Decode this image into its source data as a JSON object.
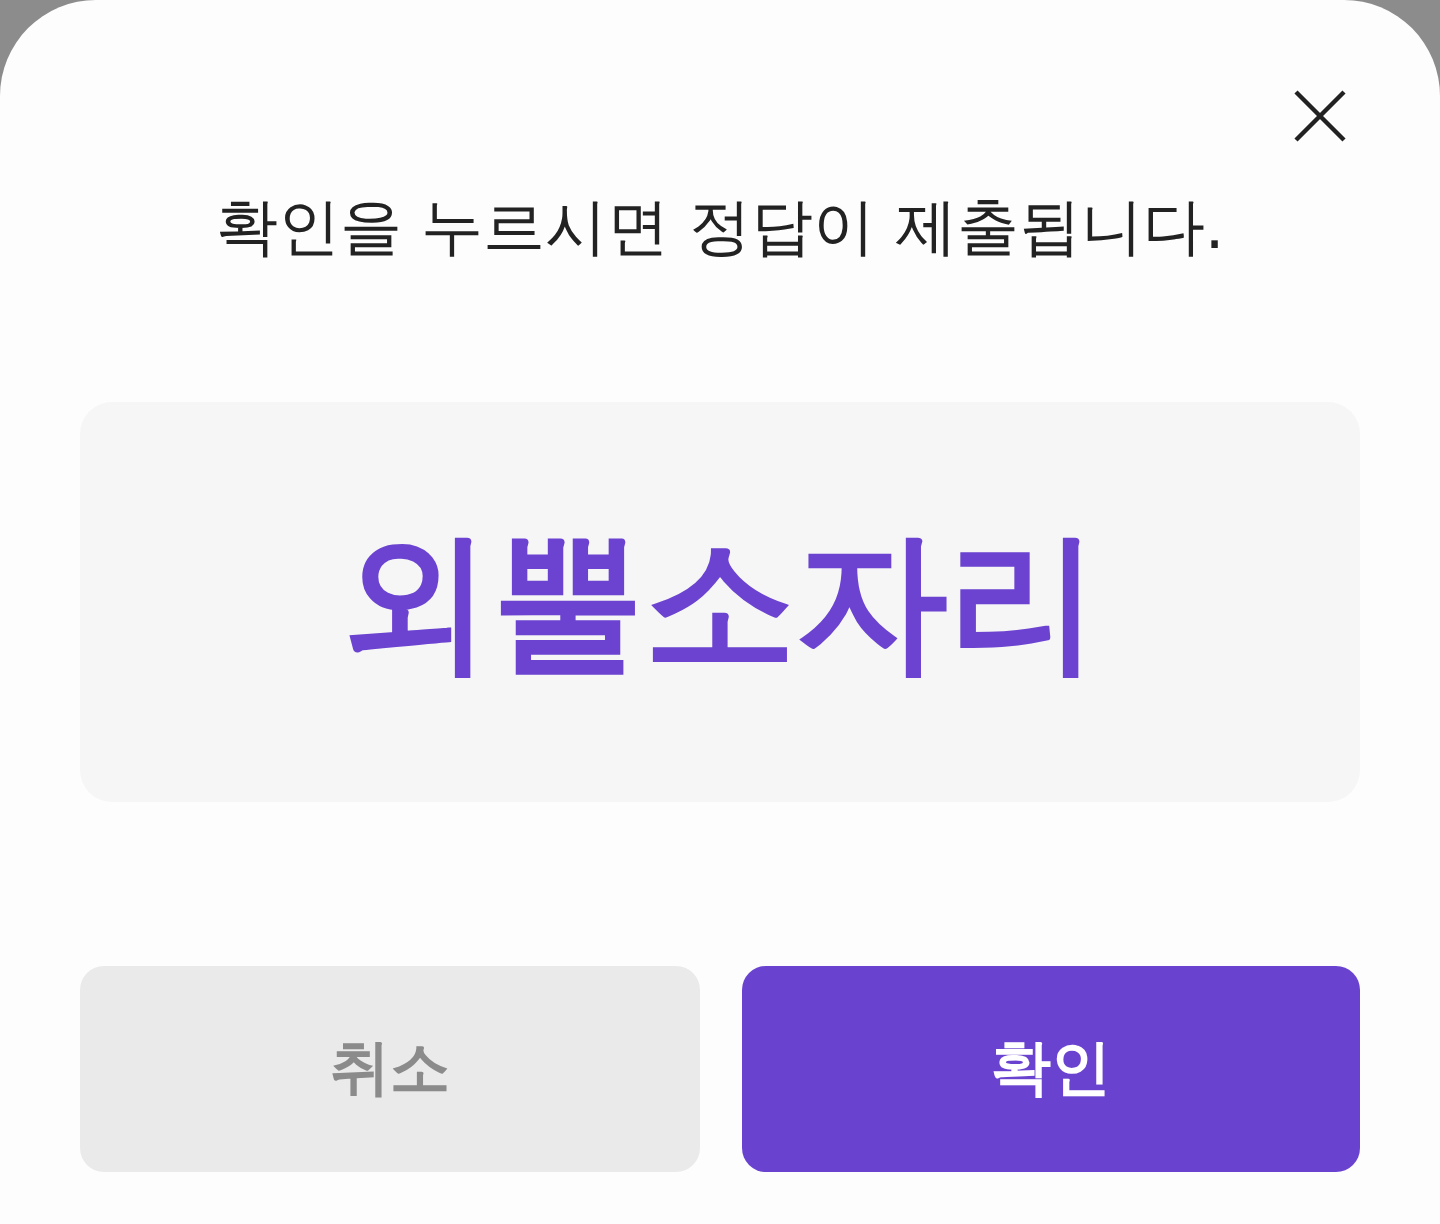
{
  "dialog": {
    "message": "확인을 누르시면 정답이 제출됩니다.",
    "answer": "외뿔소자리",
    "buttons": [
      {
        "label": "취소",
        "kind": "secondary"
      },
      {
        "label": "확인",
        "kind": "primary"
      }
    ]
  }
}
